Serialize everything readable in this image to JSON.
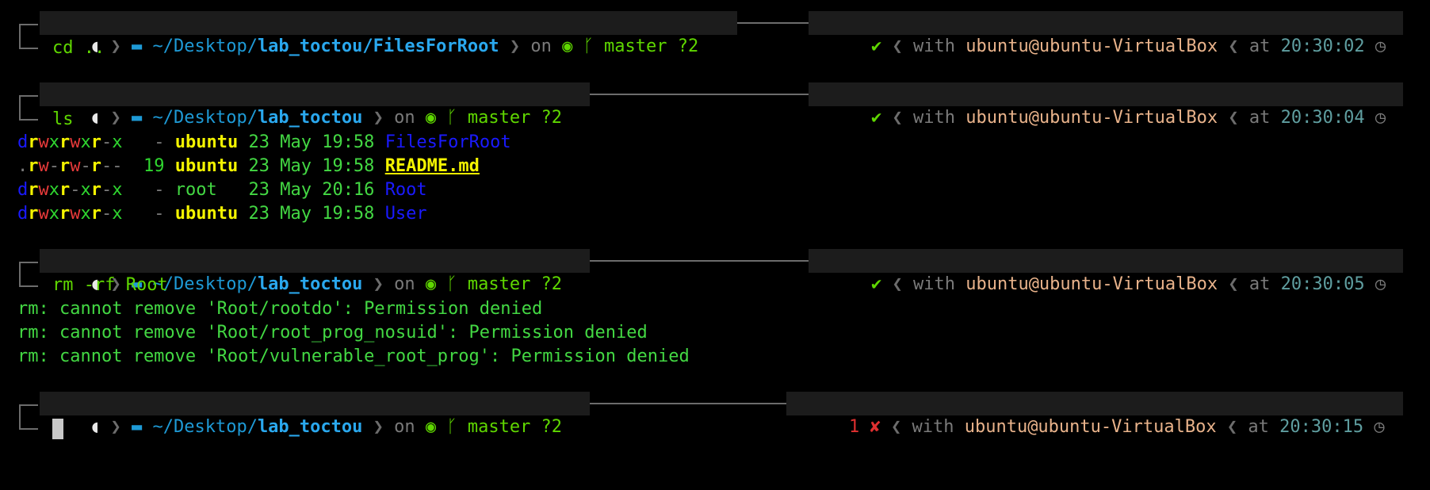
{
  "colors": {
    "git_green": "#5fd700",
    "dir_blue": "#2aa8ee",
    "user_tan": "#e9b38b",
    "time_teal": "#5f9ea0",
    "error_red": "#e03030",
    "output_green": "#43d843"
  },
  "icons": {
    "os": "apple-icon",
    "folder": "folder-icon",
    "github": "github-icon",
    "branch": "git-branch-icon",
    "check": "check-icon",
    "cross": "cross-icon",
    "clock": "clock-icon"
  },
  "prompts": [
    {
      "path_prefix": "~/Desktop/",
      "path_bold": "lab_toctou/FilesForRoot",
      "on": "on",
      "branch": "master ?2",
      "status": "✔",
      "with": "with",
      "user": "ubuntu@ubuntu-VirtualBox",
      "at": "at",
      "time": "20:30:02",
      "command": "cd .."
    },
    {
      "path_prefix": "~/Desktop/",
      "path_bold": "lab_toctou",
      "on": "on",
      "branch": "master ?2",
      "status": "✔",
      "with": "with",
      "user": "ubuntu@ubuntu-VirtualBox",
      "at": "at",
      "time": "20:30:04",
      "command": "ls"
    },
    {
      "path_prefix": "~/Desktop/",
      "path_bold": "lab_toctou",
      "on": "on",
      "branch": "master ?2",
      "status": "✔",
      "with": "with",
      "user": "ubuntu@ubuntu-VirtualBox",
      "at": "at",
      "time": "20:30:05",
      "command": "rm -rf Root"
    },
    {
      "path_prefix": "~/Desktop/",
      "path_bold": "lab_toctou",
      "on": "on",
      "branch": "master ?2",
      "status": "1 ✘",
      "with": "with",
      "user": "ubuntu@ubuntu-VirtualBox",
      "at": "at",
      "time": "20:30:15",
      "command": ""
    }
  ],
  "ls": [
    {
      "perm": [
        "d",
        "r",
        "w",
        "x",
        "r",
        "w",
        "x",
        "r",
        "-",
        "x"
      ],
      "size": " -",
      "owner": "ubuntu",
      "date": "23 May 19:58",
      "name": "FilesForRoot"
    },
    {
      "perm": [
        ".",
        "r",
        "w",
        "-",
        "r",
        "w",
        "-",
        "r",
        "-",
        "-"
      ],
      "size": "19",
      "owner": "ubuntu",
      "date": "23 May 19:58",
      "name": "README.md"
    },
    {
      "perm": [
        "d",
        "r",
        "w",
        "x",
        "r",
        "-",
        "x",
        "r",
        "-",
        "x"
      ],
      "size": " -",
      "owner": "root  ",
      "date": "23 May 20:16",
      "name": "Root"
    },
    {
      "perm": [
        "d",
        "r",
        "w",
        "x",
        "r",
        "w",
        "x",
        "r",
        "-",
        "x"
      ],
      "size": " -",
      "owner": "ubuntu",
      "date": "23 May 19:58",
      "name": "User"
    }
  ],
  "rm_errors": [
    "rm: cannot remove 'Root/rootdo': Permission denied",
    "rm: cannot remove 'Root/root_prog_nosuid': Permission denied",
    "rm: cannot remove 'Root/vulnerable_root_prog': Permission denied"
  ]
}
